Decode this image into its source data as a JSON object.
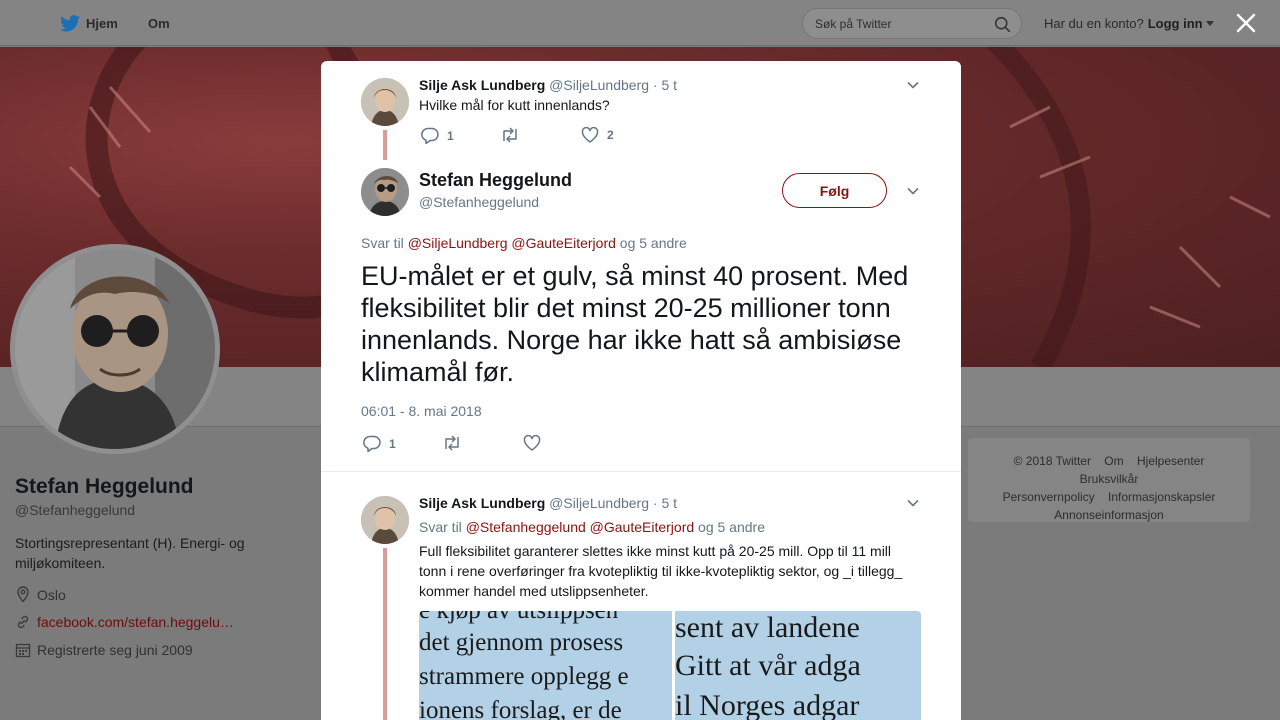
{
  "nav": {
    "home_label": "Hjem",
    "about_label": "Om",
    "search_placeholder": "Søk på Twitter",
    "account_prompt": "Har du en konto?",
    "login_label": "Logg inn"
  },
  "profile": {
    "name": "Stefan Heggelund",
    "handle": "@Stefanheggelund",
    "bio": "Stortingsrepresentant (H). Energi- og miljøkomiteen.",
    "location": "Oslo",
    "website": "facebook.com/stefan.heggelu…",
    "joined": "Registrerte seg juni 2009"
  },
  "footer": {
    "links": [
      "© 2018 Twitter",
      "Om",
      "Hjelpesenter",
      "Bruksvilkår",
      "Personvernpolicy",
      "Informasjonskapsler",
      "Annonseinformasjon"
    ]
  },
  "modal": {
    "parent_tweet": {
      "name": "Silje Ask Lundberg",
      "handle": "@SiljeLundberg",
      "time": "· 5 t",
      "text": "Hvilke mål for kutt innenlands?",
      "replies": "1",
      "likes": "2"
    },
    "main_tweet": {
      "name": "Stefan Heggelund",
      "handle": "@Stefanheggelund",
      "follow_label": "Følg",
      "reply_prefix": "Svar til",
      "reply_user1": "@SiljeLundberg",
      "reply_user2": "@GauteEiterjord",
      "reply_suffix": "og 5 andre",
      "text": "EU-målet er et gulv, så minst 40 prosent. Med fleksibilitet blir det minst 20-25 millioner tonn innenlands. Norge har ikke hatt så ambisiøse klimamål før.",
      "timestamp": "06:01 - 8. mai 2018",
      "replies": "1"
    },
    "reply_tweet": {
      "name": "Silje Ask Lundberg",
      "handle": "@SiljeLundberg",
      "time": "· 5 t",
      "reply_prefix": "Svar til",
      "reply_user1": "@Stefanheggelund",
      "reply_user2": "@GauteEiterjord",
      "reply_suffix": "og 5 andre",
      "text": "Full fleksibilitet garanterer slettes ikke minst kutt på 20-25 mill. Opp til 11 mill tonn i rene overføringer fra kvotepliktig til ikke-kvotepliktig sektor, og _i tillegg_ kommer handel med utslippsenheter.",
      "image_left_lines": [
        "e kjøp av utslippsen",
        "det gjennom prosess",
        "strammere opplegg e",
        "ionens forslag, er de"
      ],
      "image_right_lines": [
        "sent av landene",
        "Gitt at vår adga",
        "il Norges adgar"
      ]
    }
  },
  "colors": {
    "accent": "#8b1212",
    "thread_line": "#d99c99",
    "overlay": "#7b7b7b"
  }
}
